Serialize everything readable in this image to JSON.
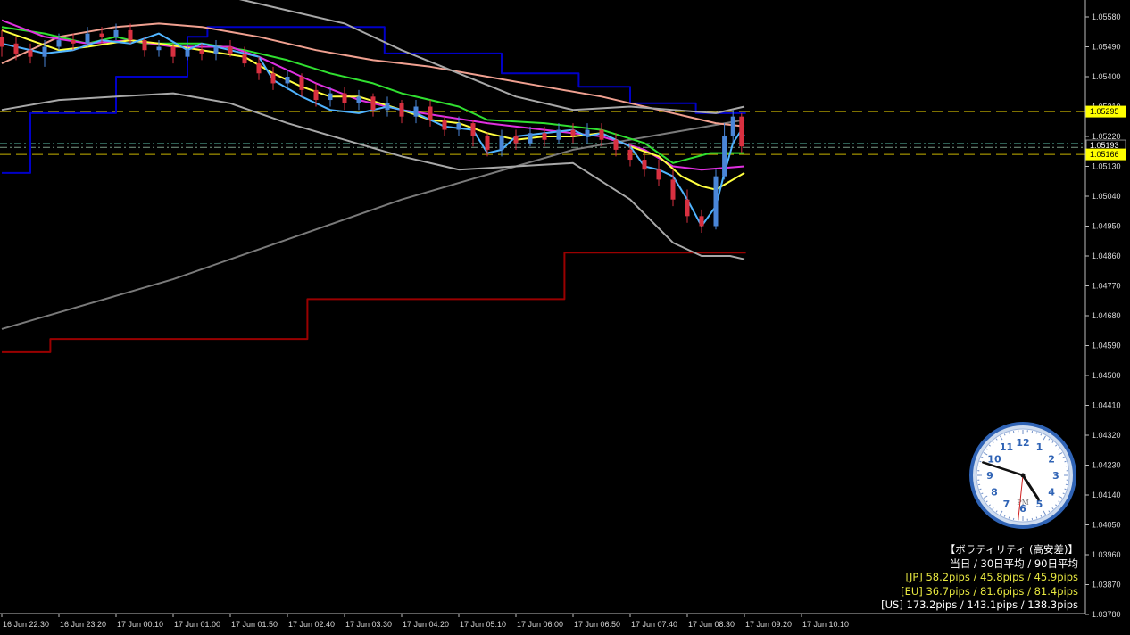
{
  "chart_data": {
    "type": "candlestick",
    "instrument_note": "",
    "y_axis": {
      "ticks": [
        "1.05580",
        "1.05490",
        "1.05400",
        "1.05310",
        "1.05220",
        "1.05130",
        "1.05040",
        "1.04950",
        "1.04860",
        "1.04770",
        "1.04680",
        "1.04590",
        "1.04500",
        "1.04410",
        "1.04320",
        "1.04230",
        "1.04140",
        "1.04050",
        "1.03960",
        "1.03870",
        "1.03780"
      ],
      "range": [
        1.0378,
        1.0558
      ]
    },
    "x_axis": {
      "ticks": [
        "16 Jun 22:30",
        "16 Jun 23:20",
        "17 Jun 00:10",
        "17 Jun 01:00",
        "17 Jun 01:50",
        "17 Jun 02:40",
        "17 Jun 03:30",
        "17 Jun 04:20",
        "17 Jun 05:10",
        "17 Jun 06:00",
        "17 Jun 06:50",
        "17 Jun 07:40",
        "17 Jun 08:30",
        "17 Jun 09:20",
        "17 Jun 10:10"
      ]
    },
    "price_markers": [
      {
        "label": "1.05295",
        "value": 1.05295,
        "bg": "#ffff00",
        "fg": "#000000"
      },
      {
        "label": "1.05193",
        "value": 1.05193,
        "bg": "#000000",
        "fg": "#ffffff"
      },
      {
        "label": "1.05166",
        "value": 1.05166,
        "bg": "#ffff00",
        "fg": "#000000"
      }
    ],
    "horizontal_lines": [
      {
        "value": 1.05295,
        "color": "#c8b400",
        "style": "dash"
      },
      {
        "value": 1.05199,
        "color": "#4a9a86",
        "style": "dashdot"
      },
      {
        "value": 1.05187,
        "color": "#7a9a86",
        "style": "dashdot"
      },
      {
        "value": 1.05166,
        "color": "#c8b400",
        "style": "dash"
      }
    ],
    "series": [
      {
        "kind": "step",
        "color": "#0000c8",
        "points": [
          [
            0,
            1.0511
          ],
          [
            1,
            1.0511
          ],
          [
            1,
            1.0529
          ],
          [
            4,
            1.0529
          ],
          [
            4,
            1.054
          ],
          [
            6.5,
            1.054
          ],
          [
            6.5,
            1.0552
          ],
          [
            7.2,
            1.0552
          ],
          [
            7.2,
            1.0555
          ],
          [
            13.4,
            1.0555
          ],
          [
            13.4,
            1.0547
          ],
          [
            17.5,
            1.0547
          ],
          [
            17.5,
            1.0541
          ],
          [
            20.2,
            1.0541
          ],
          [
            20.2,
            1.0537
          ],
          [
            22,
            1.0537
          ],
          [
            22,
            1.0532
          ],
          [
            24.3,
            1.0532
          ],
          [
            24.3,
            1.0529
          ],
          [
            26.05,
            1.0529
          ]
        ]
      },
      {
        "kind": "step",
        "color": "#9a0000",
        "points": [
          [
            0,
            1.0457
          ],
          [
            1.7,
            1.0457
          ],
          [
            1.7,
            1.0461
          ],
          [
            10.7,
            1.0461
          ],
          [
            10.7,
            1.0473
          ],
          [
            19.7,
            1.0473
          ],
          [
            19.7,
            1.0487
          ],
          [
            26.05,
            1.0487
          ]
        ]
      },
      {
        "kind": "line",
        "color": "#7a7a7a",
        "points": [
          [
            0,
            1.0464
          ],
          [
            2,
            1.0469
          ],
          [
            4,
            1.0474
          ],
          [
            6,
            1.0479
          ],
          [
            8,
            1.0485
          ],
          [
            10,
            1.0491
          ],
          [
            12,
            1.0497
          ],
          [
            14,
            1.0503
          ],
          [
            16,
            1.0508
          ],
          [
            18,
            1.0513
          ],
          [
            20,
            1.0518
          ],
          [
            22,
            1.0521
          ],
          [
            24,
            1.0524
          ],
          [
            26,
            1.0527
          ]
        ]
      },
      {
        "kind": "line",
        "color": "#f0a090",
        "points": [
          [
            0,
            1.0544
          ],
          [
            2,
            1.0552
          ],
          [
            4,
            1.0555
          ],
          [
            5.5,
            1.0556
          ],
          [
            7,
            1.0555
          ],
          [
            9,
            1.0552
          ],
          [
            11,
            1.0548
          ],
          [
            13,
            1.0545
          ],
          [
            15,
            1.0543
          ],
          [
            17,
            1.054
          ],
          [
            19,
            1.0537
          ],
          [
            21,
            1.0534
          ],
          [
            23,
            1.053
          ],
          [
            25,
            1.0526
          ],
          [
            26,
            1.0525
          ]
        ]
      },
      {
        "kind": "line",
        "color": "#30e030",
        "points": [
          [
            0,
            1.0555
          ],
          [
            1.5,
            1.0553
          ],
          [
            3,
            1.055
          ],
          [
            4,
            1.0552
          ],
          [
            5,
            1.055
          ],
          [
            7,
            1.055
          ],
          [
            8.5,
            1.0548
          ],
          [
            10,
            1.0545
          ],
          [
            11.5,
            1.0541
          ],
          [
            13,
            1.0538
          ],
          [
            14,
            1.0535
          ],
          [
            16,
            1.0531
          ],
          [
            17,
            1.0527
          ],
          [
            19,
            1.0526
          ],
          [
            21,
            1.0524
          ],
          [
            22.5,
            1.052
          ],
          [
            23.5,
            1.0514
          ],
          [
            24.8,
            1.0517
          ],
          [
            26,
            1.0517
          ]
        ]
      },
      {
        "kind": "line",
        "color": "#e030e0",
        "points": [
          [
            0,
            1.0557
          ],
          [
            1.5,
            1.0552
          ],
          [
            3,
            1.055
          ],
          [
            4.5,
            1.0551
          ],
          [
            6,
            1.0549
          ],
          [
            8,
            1.0549
          ],
          [
            9,
            1.0546
          ],
          [
            10,
            1.0542
          ],
          [
            11,
            1.0538
          ],
          [
            12.5,
            1.0533
          ],
          [
            14,
            1.053
          ],
          [
            15.5,
            1.0528
          ],
          [
            17,
            1.0526
          ],
          [
            19,
            1.0524
          ],
          [
            21,
            1.0522
          ],
          [
            22.5,
            1.0518
          ],
          [
            23.5,
            1.0513
          ],
          [
            24.5,
            1.0512
          ],
          [
            26,
            1.0513
          ]
        ]
      },
      {
        "kind": "line",
        "color": "#ffff40",
        "points": [
          [
            0,
            1.0554
          ],
          [
            1,
            1.0551
          ],
          [
            2,
            1.0548
          ],
          [
            3,
            1.0549
          ],
          [
            4.5,
            1.0551
          ],
          [
            5.5,
            1.055
          ],
          [
            7,
            1.0548
          ],
          [
            8.5,
            1.0546
          ],
          [
            9.5,
            1.0541
          ],
          [
            10.5,
            1.0537
          ],
          [
            11.5,
            1.0534
          ],
          [
            12.5,
            1.0534
          ],
          [
            14,
            1.053
          ],
          [
            15,
            1.0527
          ],
          [
            16,
            1.0526
          ],
          [
            17,
            1.0523
          ],
          [
            18,
            1.0521
          ],
          [
            19,
            1.0522
          ],
          [
            20,
            1.0522
          ],
          [
            21,
            1.0523
          ],
          [
            22,
            1.0519
          ],
          [
            23,
            1.0516
          ],
          [
            23.8,
            1.051
          ],
          [
            24.5,
            1.0507
          ],
          [
            25,
            1.0506
          ],
          [
            26,
            1.0511
          ]
        ]
      },
      {
        "kind": "line",
        "color": "#50b4ff",
        "points": [
          [
            0,
            1.055
          ],
          [
            0.5,
            1.0549
          ],
          [
            1.5,
            1.0547
          ],
          [
            2.5,
            1.0548
          ],
          [
            3.5,
            1.0551
          ],
          [
            4.5,
            1.055
          ],
          [
            5.5,
            1.0553
          ],
          [
            6.5,
            1.0548
          ],
          [
            7,
            1.055
          ],
          [
            8,
            1.0548
          ],
          [
            9,
            1.0546
          ],
          [
            9.5,
            1.0539
          ],
          [
            10.5,
            1.0534
          ],
          [
            11.5,
            1.053
          ],
          [
            12.5,
            1.0529
          ],
          [
            13.5,
            1.0531
          ],
          [
            14.5,
            1.0529
          ],
          [
            15.5,
            1.0525
          ],
          [
            16.5,
            1.0524
          ],
          [
            17,
            1.0517
          ],
          [
            17.5,
            1.0518
          ],
          [
            18,
            1.0522
          ],
          [
            19,
            1.0523
          ],
          [
            20,
            1.0524
          ],
          [
            20.5,
            1.0522
          ],
          [
            21,
            1.0523
          ],
          [
            22,
            1.0519
          ],
          [
            22.5,
            1.0513
          ],
          [
            23,
            1.0512
          ],
          [
            23.5,
            1.051
          ],
          [
            24,
            1.0503
          ],
          [
            24.5,
            1.0495
          ],
          [
            25,
            1.0501
          ],
          [
            25.3,
            1.0511
          ],
          [
            25.6,
            1.052
          ],
          [
            25.9,
            1.0524
          ],
          [
            26,
            1.0522
          ]
        ]
      },
      {
        "kind": "line",
        "color": "#a8a8a8",
        "points": [
          [
            0,
            1.057
          ],
          [
            2,
            1.0566
          ],
          [
            4,
            1.0565
          ],
          [
            6,
            1.0565
          ],
          [
            8,
            1.0564
          ],
          [
            10,
            1.056
          ],
          [
            12,
            1.0556
          ],
          [
            14,
            1.0548
          ],
          [
            16,
            1.0541
          ],
          [
            18,
            1.0534
          ],
          [
            20,
            1.053
          ],
          [
            22,
            1.0531
          ],
          [
            23.5,
            1.053
          ],
          [
            25,
            1.0529
          ],
          [
            26,
            1.0531
          ]
        ]
      },
      {
        "kind": "line",
        "color": "#a8a8a8",
        "points": [
          [
            0,
            1.053
          ],
          [
            2,
            1.0533
          ],
          [
            4,
            1.0534
          ],
          [
            6,
            1.0535
          ],
          [
            8,
            1.0532
          ],
          [
            10,
            1.0526
          ],
          [
            12,
            1.0521
          ],
          [
            14,
            1.0516
          ],
          [
            16,
            1.0512
          ],
          [
            18,
            1.0513
          ],
          [
            20,
            1.0514
          ],
          [
            22,
            1.0503
          ],
          [
            23.5,
            1.049
          ],
          [
            24.5,
            1.0486
          ],
          [
            25.5,
            1.0486
          ],
          [
            26,
            1.0485
          ]
        ]
      }
    ],
    "candles": [
      [
        0,
        1.0552,
        1.0549,
        1.0554,
        1.0546
      ],
      [
        0.5,
        1.055,
        1.0547,
        1.0552,
        1.0545
      ],
      [
        1,
        1.0548,
        1.0546,
        1.055,
        1.0544
      ],
      [
        1.5,
        1.0546,
        1.0549,
        1.0551,
        1.0543
      ],
      [
        2,
        1.0549,
        1.0551,
        1.0553,
        1.0548
      ],
      [
        2.5,
        1.0551,
        1.055,
        1.0553,
        1.0548
      ],
      [
        3,
        1.055,
        1.0553,
        1.0555,
        1.0549
      ],
      [
        3.5,
        1.0553,
        1.0552,
        1.0555,
        1.055
      ],
      [
        4,
        1.0552,
        1.0554,
        1.0556,
        1.0551
      ],
      [
        4.5,
        1.0554,
        1.0551,
        1.0556,
        1.055
      ],
      [
        5,
        1.0551,
        1.0548,
        1.0552,
        1.0546
      ],
      [
        5.5,
        1.0548,
        1.0549,
        1.0551,
        1.0546
      ],
      [
        6,
        1.0549,
        1.0546,
        1.055,
        1.0544
      ],
      [
        6.5,
        1.0546,
        1.0548,
        1.055,
        1.0545
      ],
      [
        7,
        1.0548,
        1.0547,
        1.055,
        1.0545
      ],
      [
        7.5,
        1.0547,
        1.0549,
        1.0551,
        1.0545
      ],
      [
        8,
        1.0549,
        1.0547,
        1.0551,
        1.0546
      ],
      [
        8.5,
        1.0547,
        1.0544,
        1.0549,
        1.0543
      ],
      [
        9,
        1.0544,
        1.0541,
        1.0546,
        1.0539
      ],
      [
        9.5,
        1.0541,
        1.0538,
        1.0543,
        1.0536
      ],
      [
        10,
        1.0538,
        1.054,
        1.0542,
        1.0536
      ],
      [
        10.5,
        1.054,
        1.0536,
        1.0541,
        1.0534
      ],
      [
        11,
        1.0536,
        1.0533,
        1.0538,
        1.0531
      ],
      [
        11.5,
        1.0533,
        1.0535,
        1.0537,
        1.0531
      ],
      [
        12,
        1.0535,
        1.0532,
        1.0537,
        1.053
      ],
      [
        12.5,
        1.0532,
        1.0534,
        1.0536,
        1.053
      ],
      [
        13,
        1.0534,
        1.053,
        1.0535,
        1.0528
      ],
      [
        13.5,
        1.053,
        1.0532,
        1.0534,
        1.0528
      ],
      [
        14,
        1.0532,
        1.0528,
        1.0533,
        1.0526
      ],
      [
        14.5,
        1.0528,
        1.0531,
        1.0533,
        1.0526
      ],
      [
        15,
        1.0531,
        1.0527,
        1.0533,
        1.0525
      ],
      [
        15.5,
        1.0527,
        1.0524,
        1.0528,
        1.0522
      ],
      [
        16,
        1.0524,
        1.0526,
        1.0528,
        1.0522
      ],
      [
        16.5,
        1.0526,
        1.0522,
        1.0527,
        1.0519
      ],
      [
        17,
        1.0522,
        1.0518,
        1.0523,
        1.0516
      ],
      [
        17.5,
        1.0518,
        1.0522,
        1.0524,
        1.0516
      ],
      [
        18,
        1.0522,
        1.052,
        1.0524,
        1.0518
      ],
      [
        18.5,
        1.052,
        1.0523,
        1.0525,
        1.0519
      ],
      [
        19,
        1.0523,
        1.0521,
        1.0525,
        1.0519
      ],
      [
        19.5,
        1.0521,
        1.0524,
        1.0526,
        1.052
      ],
      [
        20,
        1.0524,
        1.0522,
        1.0526,
        1.052
      ],
      [
        20.5,
        1.0522,
        1.0524,
        1.0526,
        1.052
      ],
      [
        21,
        1.0524,
        1.0521,
        1.0526,
        1.0519
      ],
      [
        21.5,
        1.0521,
        1.0518,
        1.0523,
        1.0516
      ],
      [
        22,
        1.0518,
        1.0515,
        1.052,
        1.0513
      ],
      [
        22.5,
        1.0515,
        1.0512,
        1.0517,
        1.051
      ],
      [
        23,
        1.0512,
        1.0509,
        1.0515,
        1.0507
      ],
      [
        23.5,
        1.0509,
        1.0503,
        1.0512,
        1.0501
      ],
      [
        24,
        1.0503,
        1.0498,
        1.0506,
        1.0496
      ],
      [
        24.5,
        1.0498,
        1.0495,
        1.05,
        1.0493
      ],
      [
        25,
        1.0495,
        1.051,
        1.0512,
        1.0494
      ],
      [
        25.3,
        1.051,
        1.0522,
        1.0526,
        1.0509
      ],
      [
        25.6,
        1.0522,
        1.0528,
        1.053,
        1.052
      ],
      [
        25.9,
        1.0528,
        1.0519,
        1.0529,
        1.0517
      ]
    ],
    "up_color": "#4a86d8",
    "down_color": "#d83040"
  },
  "clock": {
    "numbers": [
      "12",
      "1",
      "2",
      "3",
      "4",
      "5",
      "6",
      "7",
      "8",
      "9",
      "10",
      "11"
    ],
    "ampm": "PM",
    "hour": 4.9,
    "minute": 48,
    "second": 31
  },
  "info_panel": {
    "title": "【ボラティリティ (高安差)】",
    "subtitle": "当日 / 30日平均 / 90日平均",
    "rows": [
      {
        "text": "[JP] 58.2pips / 45.8pips / 45.9pips",
        "color": "#e8e840"
      },
      {
        "text": "[EU] 36.7pips / 81.6pips / 81.4pips",
        "color": "#e8e840"
      },
      {
        "text": "[US] 173.2pips / 143.1pips / 138.3pips",
        "color": "#ffffff"
      }
    ]
  }
}
